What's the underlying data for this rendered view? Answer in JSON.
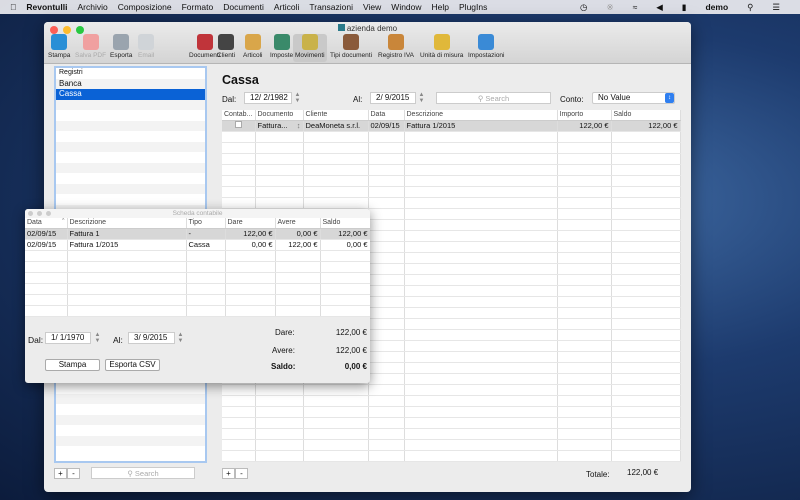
{
  "menubar": {
    "app": "Revontulli",
    "items": [
      "Archivio",
      "Composizione",
      "Formato",
      "Documenti",
      "Articoli",
      "Transazioni",
      "View",
      "Window",
      "Help",
      "PlugIns"
    ],
    "user": "demo"
  },
  "window": {
    "title": "azienda demo"
  },
  "toolbar": [
    {
      "label": "Stampa",
      "color": "#2a8fd6",
      "enabled": true
    },
    {
      "label": "Salva PDF",
      "color": "#f0a0a0",
      "enabled": false
    },
    {
      "label": "Esporta",
      "color": "#9aa4ae",
      "enabled": true
    },
    {
      "label": "Email",
      "color": "#d0d4d8",
      "enabled": false
    },
    {
      "label": "Documenti",
      "color": "#c0343a",
      "enabled": true
    },
    {
      "label": "Clienti",
      "color": "#444444",
      "enabled": true
    },
    {
      "label": "Articoli",
      "color": "#d9a64a",
      "enabled": true
    },
    {
      "label": "Imposte",
      "color": "#3a8a6a",
      "enabled": true
    },
    {
      "label": "Movimenti",
      "color": "#c9b24a",
      "enabled": true,
      "selected": true
    },
    {
      "label": "Tipi documenti",
      "color": "#8a5a3a",
      "enabled": true
    },
    {
      "label": "Registro IVA",
      "color": "#c9863a",
      "enabled": true
    },
    {
      "label": "Unità di misura",
      "color": "#e0b83a",
      "enabled": true
    },
    {
      "label": "Impostazioni",
      "color": "#3a8ad6",
      "enabled": true
    }
  ],
  "sidebar": {
    "items": [
      "Registri",
      "Banca",
      "Cassa"
    ],
    "selected": 2,
    "search_placeholder": "Search",
    "add": "+",
    "remove": "-"
  },
  "main": {
    "title": "Cassa",
    "from_label": "Dal:",
    "from": "12/ 2/1982",
    "to_label": "Al:",
    "to": "2/ 9/2015",
    "search_placeholder": "Search",
    "account_label": "Conto:",
    "account": "No Value",
    "columns": [
      "Contab...",
      "Documento",
      "Cliente",
      "Data",
      "Descrizione",
      "Importo",
      "Saldo"
    ],
    "rows": [
      {
        "checked": false,
        "documento": "Fattura...",
        "cliente": "DeaMoneta s.r.l.",
        "data": "02/09/15",
        "descrizione": "Fattura 1/2015",
        "importo": "122,00 €",
        "saldo": "122,00 €"
      }
    ],
    "total_label": "Totale:",
    "total": "122,00 €",
    "add": "+",
    "remove": "-"
  },
  "panel": {
    "title": "Scheda contabile",
    "columns": [
      "Data",
      "Descrizione",
      "Tipo",
      "Dare",
      "Avere",
      "Saldo"
    ],
    "rows": [
      [
        "02/09/15",
        "Fattura 1",
        "-",
        "122,00 €",
        "0,00 €",
        "122,00 €"
      ],
      [
        "02/09/15",
        "Fattura 1/2015",
        "Cassa",
        "0,00 €",
        "122,00 €",
        "0,00 €"
      ]
    ],
    "from_label": "Dal:",
    "from": "1/ 1/1970",
    "to_label": "Al:",
    "to": "3/ 9/2015",
    "dare_label": "Dare:",
    "dare": "122,00 €",
    "avere_label": "Avere:",
    "avere": "122,00 €",
    "saldo_label": "Saldo:",
    "saldo": "0,00 €",
    "print": "Stampa",
    "export": "Esporta CSV"
  }
}
